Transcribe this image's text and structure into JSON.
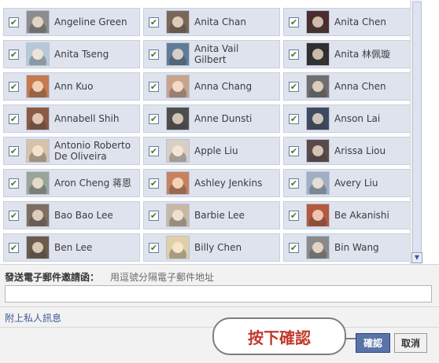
{
  "friends": [
    {
      "name": "Angeline Green",
      "checked": true,
      "color": "#8d8d8d"
    },
    {
      "name": "Anita Chan",
      "checked": true,
      "color": "#7b6758"
    },
    {
      "name": "Anita Chen",
      "checked": true,
      "color": "#4a2e2e"
    },
    {
      "name": "Anita Tseng",
      "checked": true,
      "color": "#b7c9d9"
    },
    {
      "name": "Anita Vail Gilbert",
      "checked": true,
      "color": "#5f7d99"
    },
    {
      "name": "Anita 林佩璇",
      "checked": true,
      "color": "#2f2f2f"
    },
    {
      "name": "Ann Kuo",
      "checked": true,
      "color": "#c77a4e"
    },
    {
      "name": "Anna Chang",
      "checked": true,
      "color": "#c9a48a"
    },
    {
      "name": "Anna Chen",
      "checked": true,
      "color": "#6f6f6f"
    },
    {
      "name": "Annabell Shih",
      "checked": true,
      "color": "#8b5a45"
    },
    {
      "name": "Anne Dunsti",
      "checked": true,
      "color": "#4e4e4e"
    },
    {
      "name": "Anson Lai",
      "checked": true,
      "color": "#3e4a5f"
    },
    {
      "name": "Antonio Roberto De Oliveira",
      "checked": true,
      "color": "#d7c2a8"
    },
    {
      "name": "Apple Liu",
      "checked": true,
      "color": "#d8cfc4"
    },
    {
      "name": "Arissa Liou",
      "checked": true,
      "color": "#5a4a4a"
    },
    {
      "name": "Aron Cheng 蒋恩",
      "checked": true,
      "color": "#9aa59a"
    },
    {
      "name": "Ashley Jenkins",
      "checked": true,
      "color": "#c9825e"
    },
    {
      "name": "Avery Liu",
      "checked": true,
      "color": "#9fb0c4"
    },
    {
      "name": "Bao Bao Lee",
      "checked": true,
      "color": "#7e6f62"
    },
    {
      "name": "Barbie Lee",
      "checked": true,
      "color": "#c7b8a6"
    },
    {
      "name": "Be Akanishi",
      "checked": true,
      "color": "#b55a3c"
    },
    {
      "name": "Ben Lee",
      "checked": true,
      "color": "#6c5b4c"
    },
    {
      "name": "Billy Chen",
      "checked": true,
      "color": "#e1cfa8"
    },
    {
      "name": "Bin Wang",
      "checked": true,
      "color": "#8a8a8a"
    }
  ],
  "email": {
    "label": "發送電子郵件邀請函：",
    "hint": "用逗號分隔電子郵件地址",
    "value": ""
  },
  "message_link": "附上私人訊息",
  "callout": "按下確認",
  "buttons": {
    "confirm": "確認",
    "cancel": "取消"
  },
  "checkmark": "✔"
}
